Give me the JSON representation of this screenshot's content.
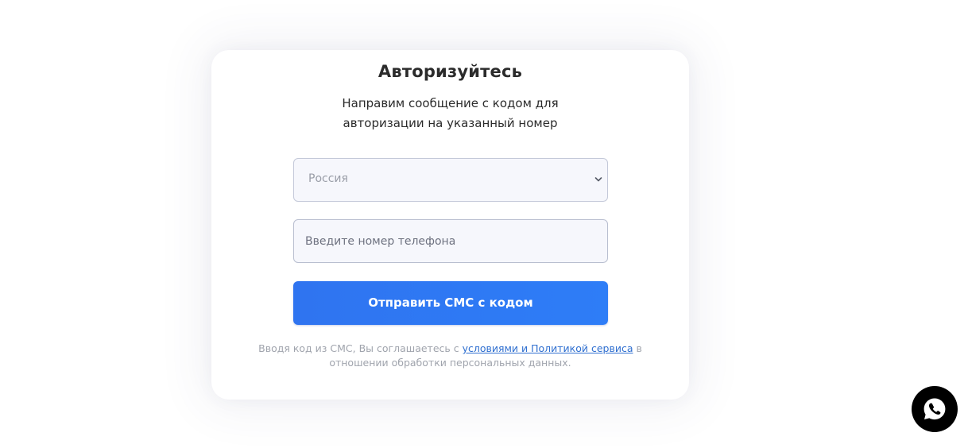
{
  "auth": {
    "title": "Авторизуйтесь",
    "subtitle": "Направим сообщение с кодом для авторизации на указанный номер",
    "country_select": {
      "selected": "Россия",
      "icon": "chevron-down-icon"
    },
    "phone_input": {
      "value": "",
      "placeholder": "Введите номер телефона"
    },
    "submit_label": "Отправить СМС с кодом",
    "legal": {
      "prefix": "Вводя код из СМС, Вы соглашаетесь с ",
      "link_text": "условиями и Политикой сервиса",
      "suffix": " в отношении обработки персональных данных."
    }
  },
  "chat_widget": {
    "icon": "whatsapp-icon"
  },
  "colors": {
    "accent": "#2f74f0",
    "link": "#2f6fd0",
    "field_background": "#f6f7fc"
  }
}
